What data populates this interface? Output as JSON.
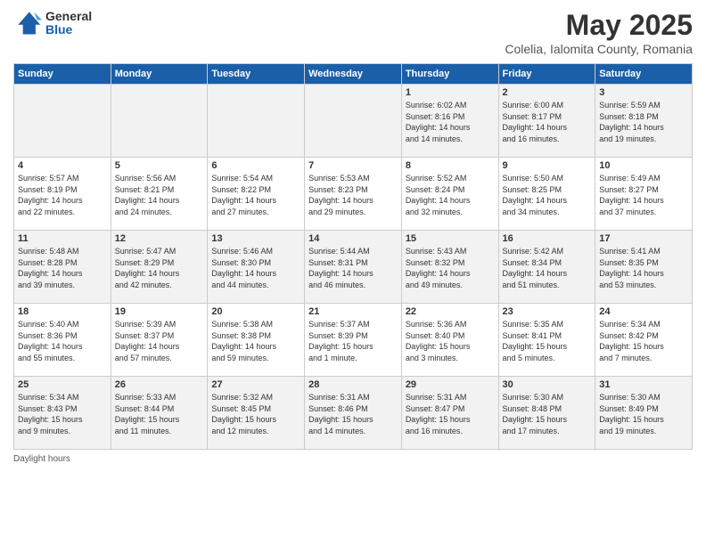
{
  "logo": {
    "general": "General",
    "blue": "Blue"
  },
  "title": "May 2025",
  "subtitle": "Colelia, Ialomita County, Romania",
  "headers": [
    "Sunday",
    "Monday",
    "Tuesday",
    "Wednesday",
    "Thursday",
    "Friday",
    "Saturday"
  ],
  "footer": "Daylight hours",
  "weeks": [
    [
      {
        "day": "",
        "info": ""
      },
      {
        "day": "",
        "info": ""
      },
      {
        "day": "",
        "info": ""
      },
      {
        "day": "",
        "info": ""
      },
      {
        "day": "1",
        "info": "Sunrise: 6:02 AM\nSunset: 8:16 PM\nDaylight: 14 hours\nand 14 minutes."
      },
      {
        "day": "2",
        "info": "Sunrise: 6:00 AM\nSunset: 8:17 PM\nDaylight: 14 hours\nand 16 minutes."
      },
      {
        "day": "3",
        "info": "Sunrise: 5:59 AM\nSunset: 8:18 PM\nDaylight: 14 hours\nand 19 minutes."
      }
    ],
    [
      {
        "day": "4",
        "info": "Sunrise: 5:57 AM\nSunset: 8:19 PM\nDaylight: 14 hours\nand 22 minutes."
      },
      {
        "day": "5",
        "info": "Sunrise: 5:56 AM\nSunset: 8:21 PM\nDaylight: 14 hours\nand 24 minutes."
      },
      {
        "day": "6",
        "info": "Sunrise: 5:54 AM\nSunset: 8:22 PM\nDaylight: 14 hours\nand 27 minutes."
      },
      {
        "day": "7",
        "info": "Sunrise: 5:53 AM\nSunset: 8:23 PM\nDaylight: 14 hours\nand 29 minutes."
      },
      {
        "day": "8",
        "info": "Sunrise: 5:52 AM\nSunset: 8:24 PM\nDaylight: 14 hours\nand 32 minutes."
      },
      {
        "day": "9",
        "info": "Sunrise: 5:50 AM\nSunset: 8:25 PM\nDaylight: 14 hours\nand 34 minutes."
      },
      {
        "day": "10",
        "info": "Sunrise: 5:49 AM\nSunset: 8:27 PM\nDaylight: 14 hours\nand 37 minutes."
      }
    ],
    [
      {
        "day": "11",
        "info": "Sunrise: 5:48 AM\nSunset: 8:28 PM\nDaylight: 14 hours\nand 39 minutes."
      },
      {
        "day": "12",
        "info": "Sunrise: 5:47 AM\nSunset: 8:29 PM\nDaylight: 14 hours\nand 42 minutes."
      },
      {
        "day": "13",
        "info": "Sunrise: 5:46 AM\nSunset: 8:30 PM\nDaylight: 14 hours\nand 44 minutes."
      },
      {
        "day": "14",
        "info": "Sunrise: 5:44 AM\nSunset: 8:31 PM\nDaylight: 14 hours\nand 46 minutes."
      },
      {
        "day": "15",
        "info": "Sunrise: 5:43 AM\nSunset: 8:32 PM\nDaylight: 14 hours\nand 49 minutes."
      },
      {
        "day": "16",
        "info": "Sunrise: 5:42 AM\nSunset: 8:34 PM\nDaylight: 14 hours\nand 51 minutes."
      },
      {
        "day": "17",
        "info": "Sunrise: 5:41 AM\nSunset: 8:35 PM\nDaylight: 14 hours\nand 53 minutes."
      }
    ],
    [
      {
        "day": "18",
        "info": "Sunrise: 5:40 AM\nSunset: 8:36 PM\nDaylight: 14 hours\nand 55 minutes."
      },
      {
        "day": "19",
        "info": "Sunrise: 5:39 AM\nSunset: 8:37 PM\nDaylight: 14 hours\nand 57 minutes."
      },
      {
        "day": "20",
        "info": "Sunrise: 5:38 AM\nSunset: 8:38 PM\nDaylight: 14 hours\nand 59 minutes."
      },
      {
        "day": "21",
        "info": "Sunrise: 5:37 AM\nSunset: 8:39 PM\nDaylight: 15 hours\nand 1 minute."
      },
      {
        "day": "22",
        "info": "Sunrise: 5:36 AM\nSunset: 8:40 PM\nDaylight: 15 hours\nand 3 minutes."
      },
      {
        "day": "23",
        "info": "Sunrise: 5:35 AM\nSunset: 8:41 PM\nDaylight: 15 hours\nand 5 minutes."
      },
      {
        "day": "24",
        "info": "Sunrise: 5:34 AM\nSunset: 8:42 PM\nDaylight: 15 hours\nand 7 minutes."
      }
    ],
    [
      {
        "day": "25",
        "info": "Sunrise: 5:34 AM\nSunset: 8:43 PM\nDaylight: 15 hours\nand 9 minutes."
      },
      {
        "day": "26",
        "info": "Sunrise: 5:33 AM\nSunset: 8:44 PM\nDaylight: 15 hours\nand 11 minutes."
      },
      {
        "day": "27",
        "info": "Sunrise: 5:32 AM\nSunset: 8:45 PM\nDaylight: 15 hours\nand 12 minutes."
      },
      {
        "day": "28",
        "info": "Sunrise: 5:31 AM\nSunset: 8:46 PM\nDaylight: 15 hours\nand 14 minutes."
      },
      {
        "day": "29",
        "info": "Sunrise: 5:31 AM\nSunset: 8:47 PM\nDaylight: 15 hours\nand 16 minutes."
      },
      {
        "day": "30",
        "info": "Sunrise: 5:30 AM\nSunset: 8:48 PM\nDaylight: 15 hours\nand 17 minutes."
      },
      {
        "day": "31",
        "info": "Sunrise: 5:30 AM\nSunset: 8:49 PM\nDaylight: 15 hours\nand 19 minutes."
      }
    ]
  ]
}
